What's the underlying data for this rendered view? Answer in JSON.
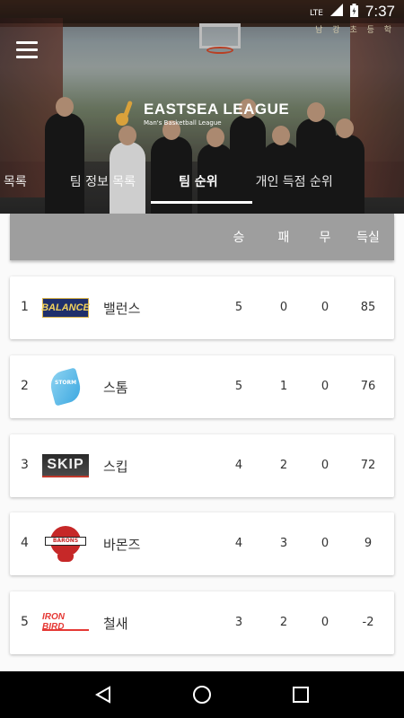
{
  "status_bar": {
    "network": "LTE",
    "time": "7:37"
  },
  "hero": {
    "title": "EASTSEA LEAGUE",
    "subtitle": "Man's Basketball League",
    "banner": "남 강 초 등 학"
  },
  "tabs": [
    {
      "label": "목록"
    },
    {
      "label": "팀 정보 목록"
    },
    {
      "label": "팀 순위",
      "active": true
    },
    {
      "label": "개인 득점 순위"
    }
  ],
  "table": {
    "headers": {
      "wins": "승",
      "losses": "패",
      "draws": "무",
      "points": "득실"
    },
    "rows": [
      {
        "rank": "1",
        "team": "밸런스",
        "logo_text": "BALANCE",
        "wins": "5",
        "losses": "0",
        "draws": "0",
        "points": "85"
      },
      {
        "rank": "2",
        "team": "스톰",
        "logo_text": "STORM",
        "wins": "5",
        "losses": "1",
        "draws": "0",
        "points": "76"
      },
      {
        "rank": "3",
        "team": "스킵",
        "logo_text": "SKIP",
        "wins": "4",
        "losses": "2",
        "draws": "0",
        "points": "72"
      },
      {
        "rank": "4",
        "team": "바몬즈",
        "logo_text": "BARONS",
        "wins": "4",
        "losses": "3",
        "draws": "0",
        "points": "9"
      },
      {
        "rank": "5",
        "team": "철새",
        "logo_text": "IRON BIRD",
        "wins": "3",
        "losses": "2",
        "draws": "0",
        "points": "-2"
      }
    ]
  },
  "colors": {
    "header_bg": "#9e9e9e",
    "card_bg": "#ffffff",
    "nav_bg": "#000000"
  }
}
